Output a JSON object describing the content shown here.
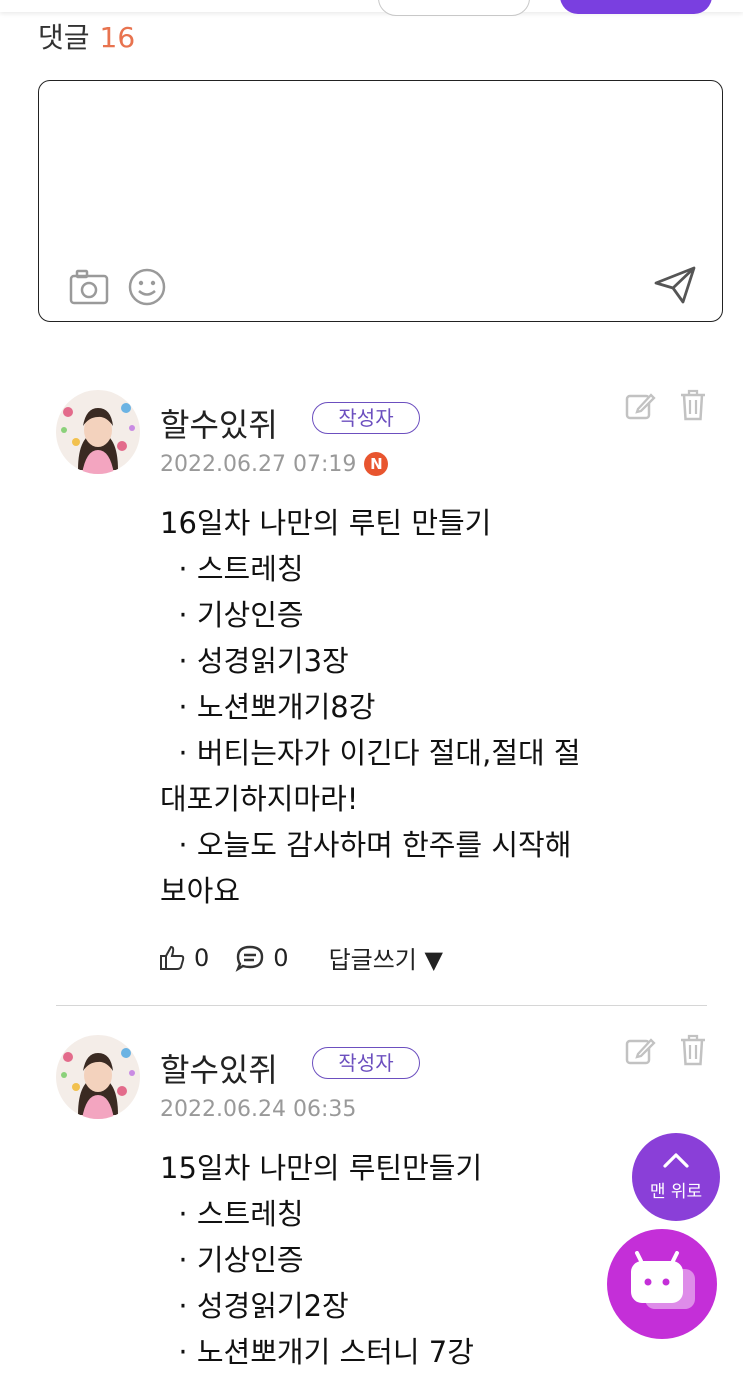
{
  "header": {
    "comments_label": "댓글",
    "comments_count": "16"
  },
  "editor": {
    "camera_icon": "camera-icon",
    "emoji_icon": "smile-icon",
    "send_icon": "send-icon"
  },
  "comments": [
    {
      "author": "할수있쥐",
      "badge": "작성자",
      "date": "2022.06.27 07:19",
      "new_badge": "N",
      "lines": [
        "16일차 나만의 루틴 만들기",
        "  · 스트레칭",
        "  · 기상인증",
        "  · 성경읽기3장",
        "  · 노션뽀개기8강",
        "  · 버티는자가 이긴다 절대,절대 절",
        "대포기하지마라!",
        "  · 오늘도 감사하며 한주를 시작해",
        "보아요"
      ],
      "likes": "0",
      "replies": "0",
      "reply_label": "답글쓰기 ▼"
    },
    {
      "author": "할수있쥐",
      "badge": "작성자",
      "date": "2022.06.24 06:35",
      "lines": [
        "15일차 나만의 루틴만들기",
        "  · 스트레칭",
        "  · 기상인증",
        "  · 성경읽기2장",
        "  · 노션뽀개기 스터니 7강"
      ]
    }
  ],
  "floating": {
    "top_label": "맨 위로",
    "chatbot_icon": "chatbot-icon"
  },
  "colors": {
    "accent": "#7a3fe0",
    "count": "#e8734f",
    "new_badge": "#e8552f",
    "chatbot": "#c42fd8"
  }
}
